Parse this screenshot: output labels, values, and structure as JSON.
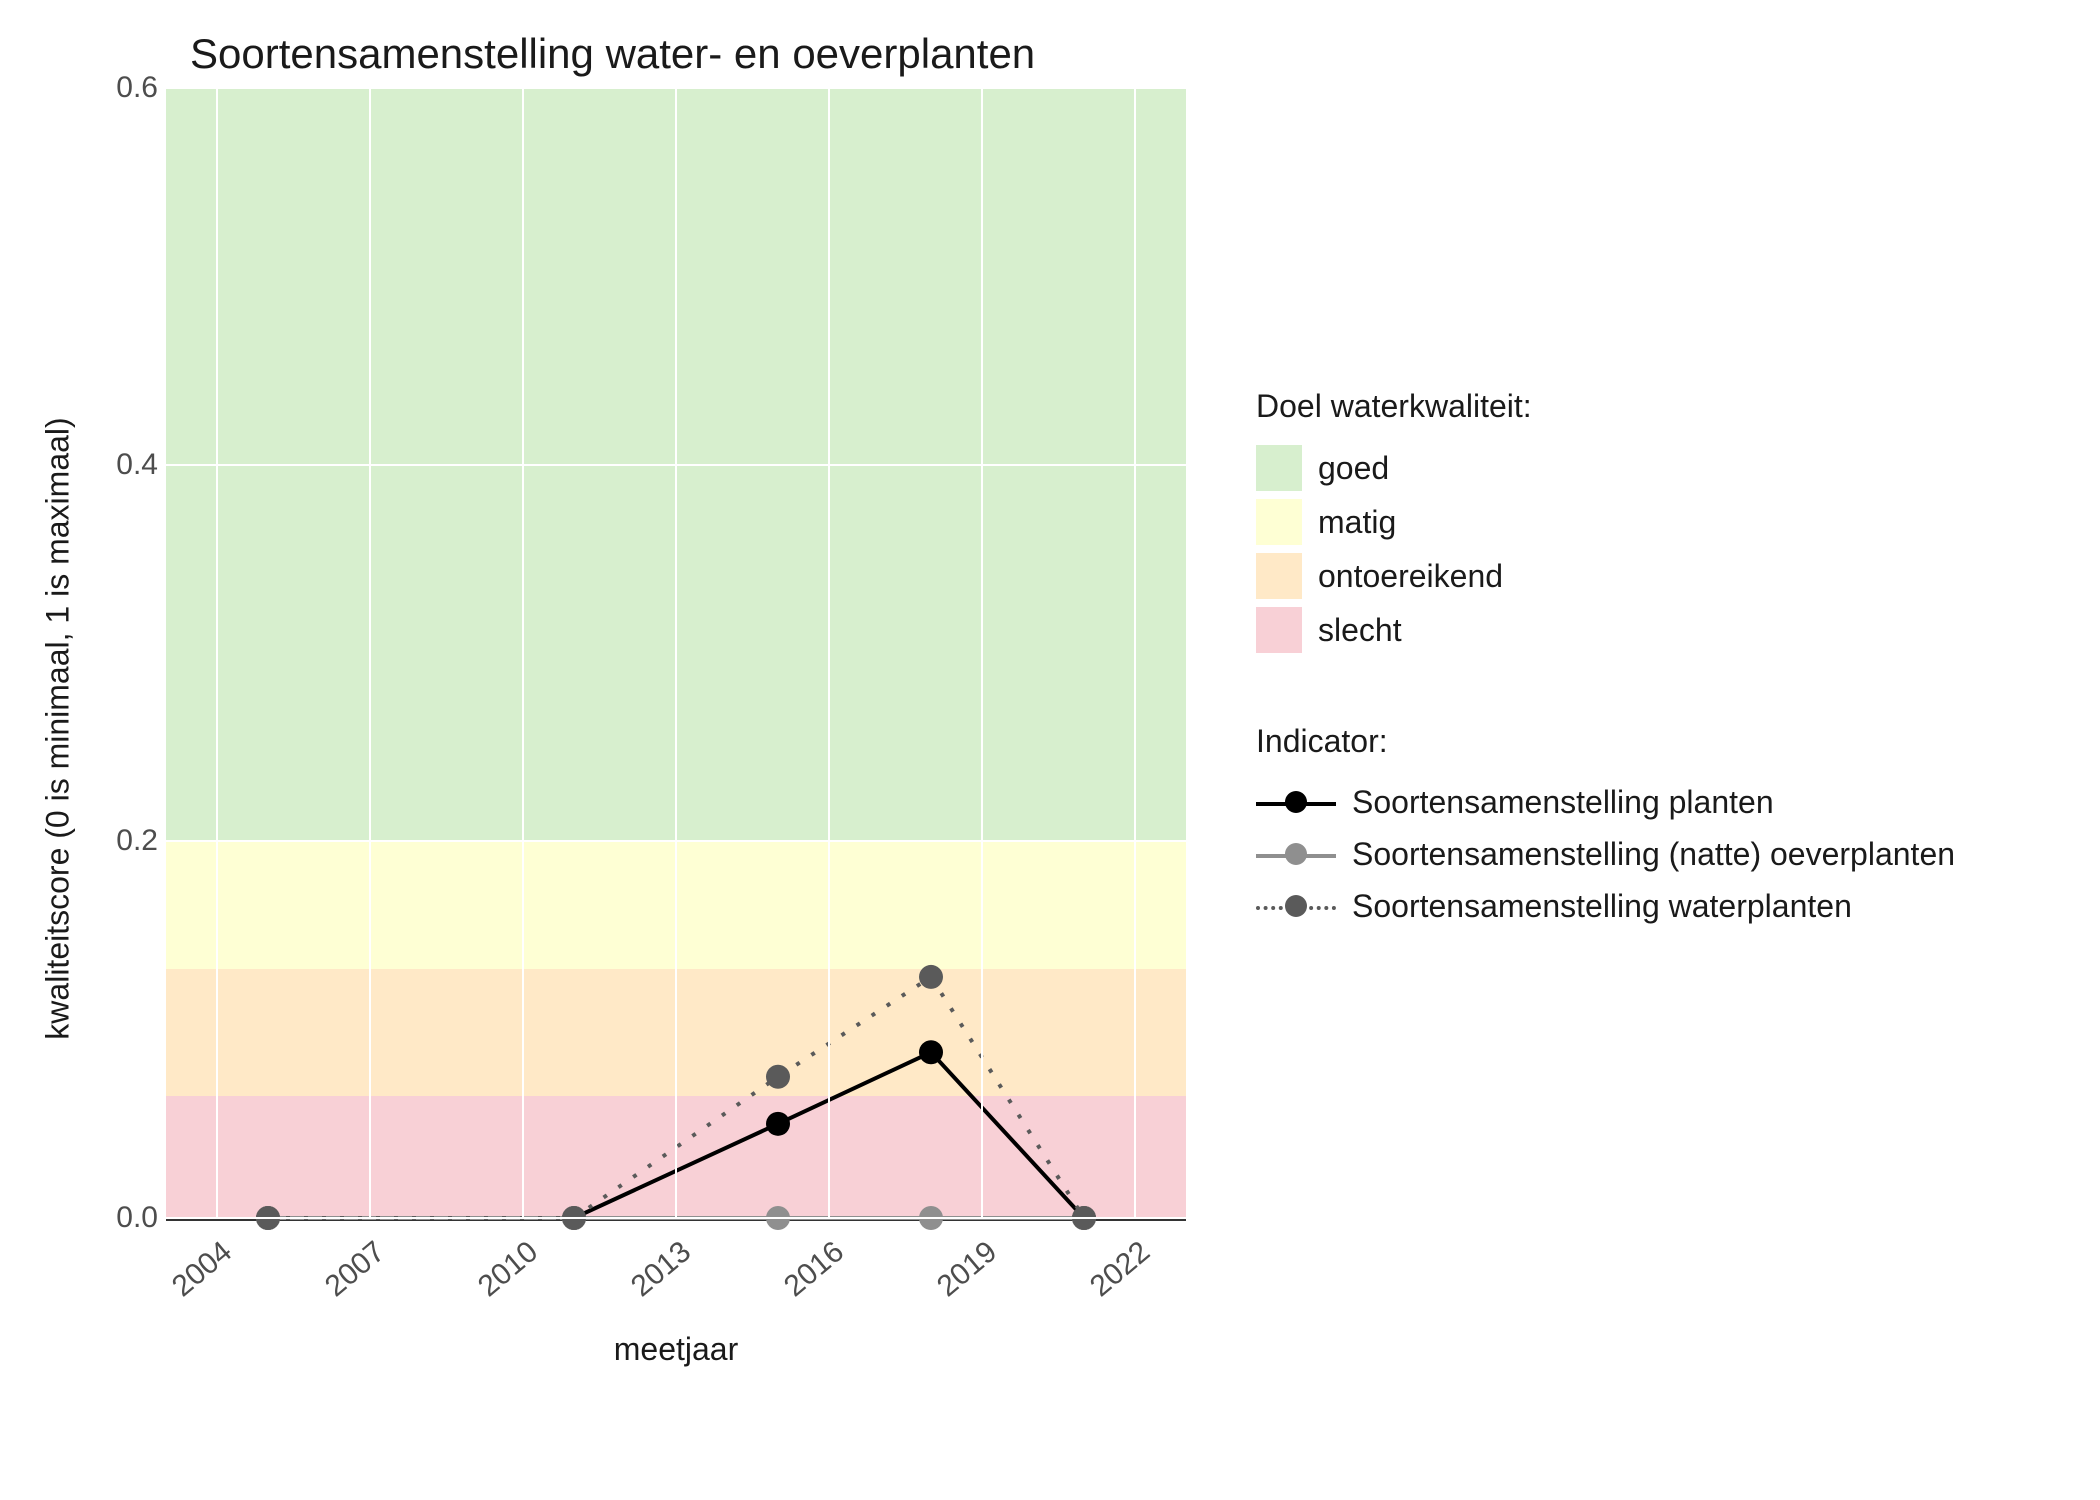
{
  "chart_data": {
    "type": "line",
    "title": "Soortensamenstelling water- en oeverplanten",
    "xlabel": "meetjaar",
    "ylabel": "kwaliteitscore (0 is minimaal, 1 is maximaal)",
    "xlim": [
      2003,
      2023
    ],
    "ylim": [
      0.0,
      0.6
    ],
    "x_ticks": [
      2004,
      2007,
      2010,
      2013,
      2016,
      2019,
      2022
    ],
    "y_ticks": [
      0.0,
      0.2,
      0.4,
      0.6
    ],
    "x": [
      2005,
      2011,
      2015,
      2018,
      2021
    ],
    "series": [
      {
        "name": "Soortensamenstelling planten",
        "values": [
          0.0,
          0.0,
          0.05,
          0.088,
          0.0
        ],
        "color": "#000000",
        "line_style": "solid"
      },
      {
        "name": "Soortensamenstelling (natte) oeverplanten",
        "values": [
          0.0,
          0.0,
          0.0,
          0.0,
          0.0
        ],
        "color": "#8f8f8f",
        "line_style": "solid"
      },
      {
        "name": "Soortensamenstelling waterplanten",
        "values": [
          0.0,
          0.0,
          0.075,
          0.128,
          0.0
        ],
        "color": "#5a5a5a",
        "line_style": "dotted"
      }
    ],
    "quality_bands": {
      "title": "Doel waterkwaliteit:",
      "bands": [
        {
          "label": "goed",
          "from": 0.2,
          "to": 0.6,
          "color": "#d7efce"
        },
        {
          "label": "matig",
          "from": 0.132,
          "to": 0.2,
          "color": "#feffd4"
        },
        {
          "label": "ontoereikend",
          "from": 0.065,
          "to": 0.132,
          "color": "#ffe9c7"
        },
        {
          "label": "slecht",
          "from": 0.0,
          "to": 0.065,
          "color": "#f8d0d6"
        }
      ]
    },
    "legend": {
      "series_title": "Indicator:",
      "position": "right"
    }
  }
}
